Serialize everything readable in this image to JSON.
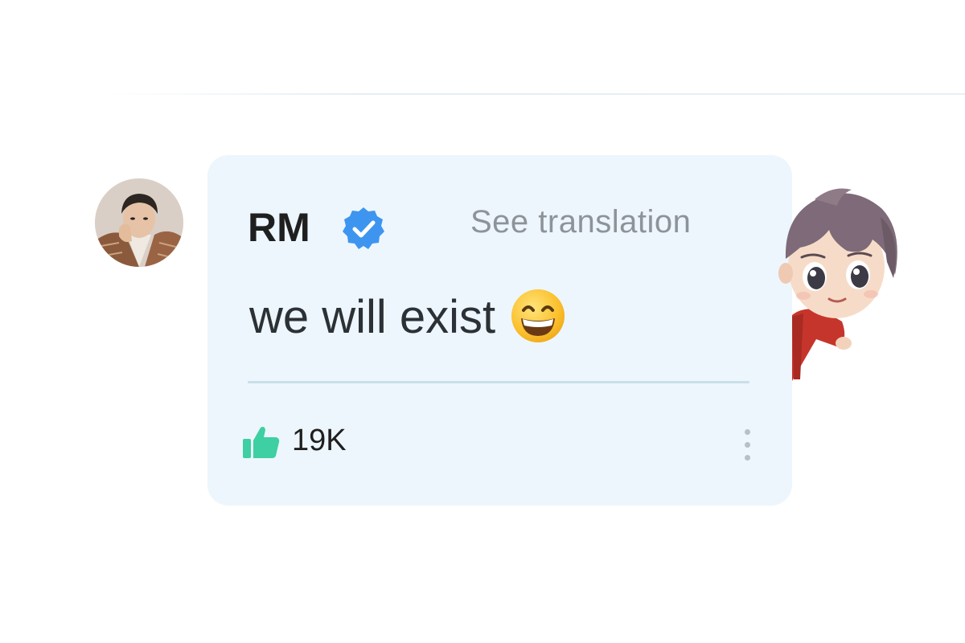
{
  "comment": {
    "username": "RM",
    "verified": true,
    "see_translation_label": "See translation",
    "text": "we will exist",
    "emoji": "grinning-face-with-smiling-eyes",
    "like_count": "19K"
  },
  "colors": {
    "bubble_background": "#edf6fc",
    "verified_badge": "#3d95f0",
    "like_icon": "#3ecfa2",
    "muted_text": "#8d9399"
  }
}
